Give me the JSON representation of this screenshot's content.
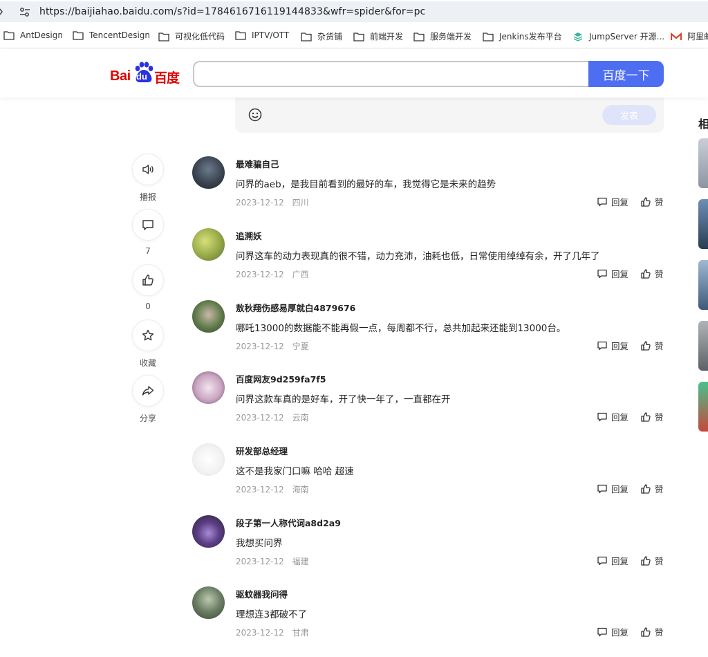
{
  "browser": {
    "url": "https://baijiahao.baidu.com/s?id=1784616716119144833&wfr=spider&for=pc",
    "bookmarks": [
      "AntDesign",
      "TencentDesign",
      "可视化低代码",
      "IPTV/OTT",
      "杂货铺",
      "前端开发",
      "服务端开发",
      "Jenkins发布平台",
      "JumpServer 开源...",
      "阿里邮"
    ]
  },
  "header": {
    "logo_bai": "Bai",
    "logo_du": "du",
    "logo_cn": "百度",
    "search_placeholder": "",
    "search_button": "百度一下"
  },
  "editor": {
    "emoji_icon": "smile-icon",
    "publish_label": "发表"
  },
  "related": {
    "title": "相"
  },
  "side_actions": [
    {
      "icon": "speaker-icon",
      "label": "播报"
    },
    {
      "icon": "comment-icon",
      "label": "7"
    },
    {
      "icon": "thumb-up-icon",
      "label": "0"
    },
    {
      "icon": "star-icon",
      "label": "收藏"
    },
    {
      "icon": "share-icon",
      "label": "分享"
    }
  ],
  "labels": {
    "reply": "回复",
    "like": "赞"
  },
  "comments": [
    {
      "name": "最难骗自己",
      "text": "问界的aeb，是我目前看到的最好的车，我觉得它是未来的趋势",
      "date": "2023-12-12",
      "region": "四川"
    },
    {
      "name": "追溯妖",
      "text": "问界这车的动力表现真的很不错，动力充沛，油耗也低，日常使用绰绰有余，开了几年了",
      "date": "2023-12-12",
      "region": "广西"
    },
    {
      "name": "敖秋翔伤感易厚就白4879676",
      "text": "哪吒13000的数据能不能再假一点，每周都不行，总共加起来还能到13000台。",
      "date": "2023-12-12",
      "region": "宁夏"
    },
    {
      "name": "百度网友9d259fa7f5",
      "text": "问界这款车真的是好车，开了快一年了，一直都在开",
      "date": "2023-12-12",
      "region": "云南"
    },
    {
      "name": "研发部总经理",
      "text": "这不是我家门口嘛 哈哈 超速",
      "date": "2023-12-12",
      "region": "海南"
    },
    {
      "name": "段子第一人称代词a8d2a9",
      "text": "我想买问界",
      "date": "2023-12-12",
      "region": "福建"
    },
    {
      "name": "驱蚊器我问得",
      "text": "理想连3都破不了",
      "date": "2023-12-12",
      "region": "甘肃"
    }
  ],
  "colors": {
    "brand_red": "#e10602",
    "brand_blue": "#4e6ef2"
  }
}
